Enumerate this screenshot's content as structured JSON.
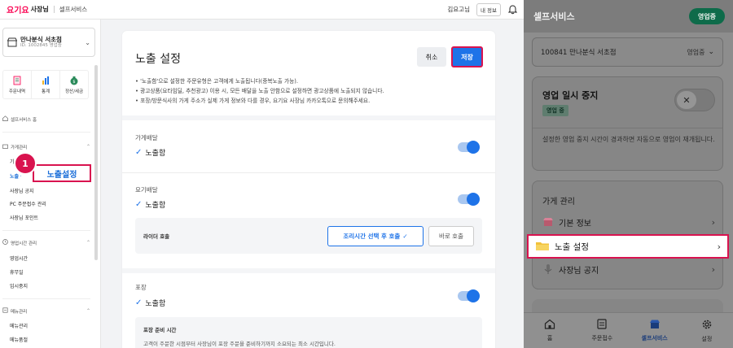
{
  "topbar": {
    "logo": "요기요",
    "logo_sub": "사장님",
    "service": "셀프서비스",
    "user": "김요고님",
    "info_button": "내 정보"
  },
  "sidebar": {
    "store_name": "만나분식 서초점",
    "store_sub": "ID. 1002845 영업중",
    "quick": [
      "주문내역",
      "통계",
      "정산/세금"
    ],
    "home": "셀프서비스 홈",
    "group_store": "가게관리",
    "store_items": [
      "기본 정보",
      "노출 설정",
      "사장님 공지",
      "PC 주문접수 관리",
      "사장님 포인트"
    ],
    "group_hours": "영업시간 관리",
    "hours_items": [
      "영업시간",
      "휴무일",
      "임시중지"
    ],
    "group_menu": "메뉴관리",
    "menu_items": [
      "메뉴관리",
      "메뉴품절"
    ]
  },
  "callout": {
    "number": "1",
    "label": "노출설정"
  },
  "main": {
    "title": "노출 설정",
    "cancel": "취소",
    "save": "저장",
    "notices": [
      "'노출함'으로 설정한 주문유형은 고객에게 노출됩니다(중복노출 가능).",
      "광고상품(요타임딜, 추천광고) 이용 시, 모든 배달을 노출 안함으로 설정하면 광고상품에 노출되지 않습니다.",
      "포장/방문식사의 가게 주소가 실제 가게 정보와 다를 경우, 요기요 사장님 카카오톡으로 문의해주세요."
    ],
    "sections": [
      {
        "label": "가게배달",
        "value": "노출함"
      },
      {
        "label": "요기배달",
        "value": "노출함"
      },
      {
        "label": "포장",
        "value": "노출함"
      }
    ],
    "rider": {
      "label": "라이더 호출",
      "option1": "조리시간 선택 후 호출",
      "option2": "바로 호출"
    },
    "prep": {
      "title": "포장 준비 시간",
      "desc": "고객이 주문한 시점부터 사장님이 포장 주문을 준비하기까지 소요되는 최소 시간입니다."
    }
  },
  "mobile": {
    "title": "셀프서비스",
    "status": "영업중",
    "store": "100841 만나분식 서초점",
    "store_status": "영업중",
    "pause_title": "영업 일시 중지",
    "pause_badge": "영업 중",
    "pause_desc": "설정한 영업 중지 시간이 경과하면 자동으로 영업이 재개됩니다.",
    "manage_title": "가게 관리",
    "rows": [
      "기본 정보",
      "노출 설정",
      "사장님 공지"
    ],
    "tabs": [
      "홈",
      "주문접수",
      "셀프서비스",
      "설정"
    ]
  },
  "colors": {
    "brand": "#fa0050",
    "accent": "#1e73e8",
    "highlight": "#d9134f",
    "open_green": "#0e6b4a"
  }
}
